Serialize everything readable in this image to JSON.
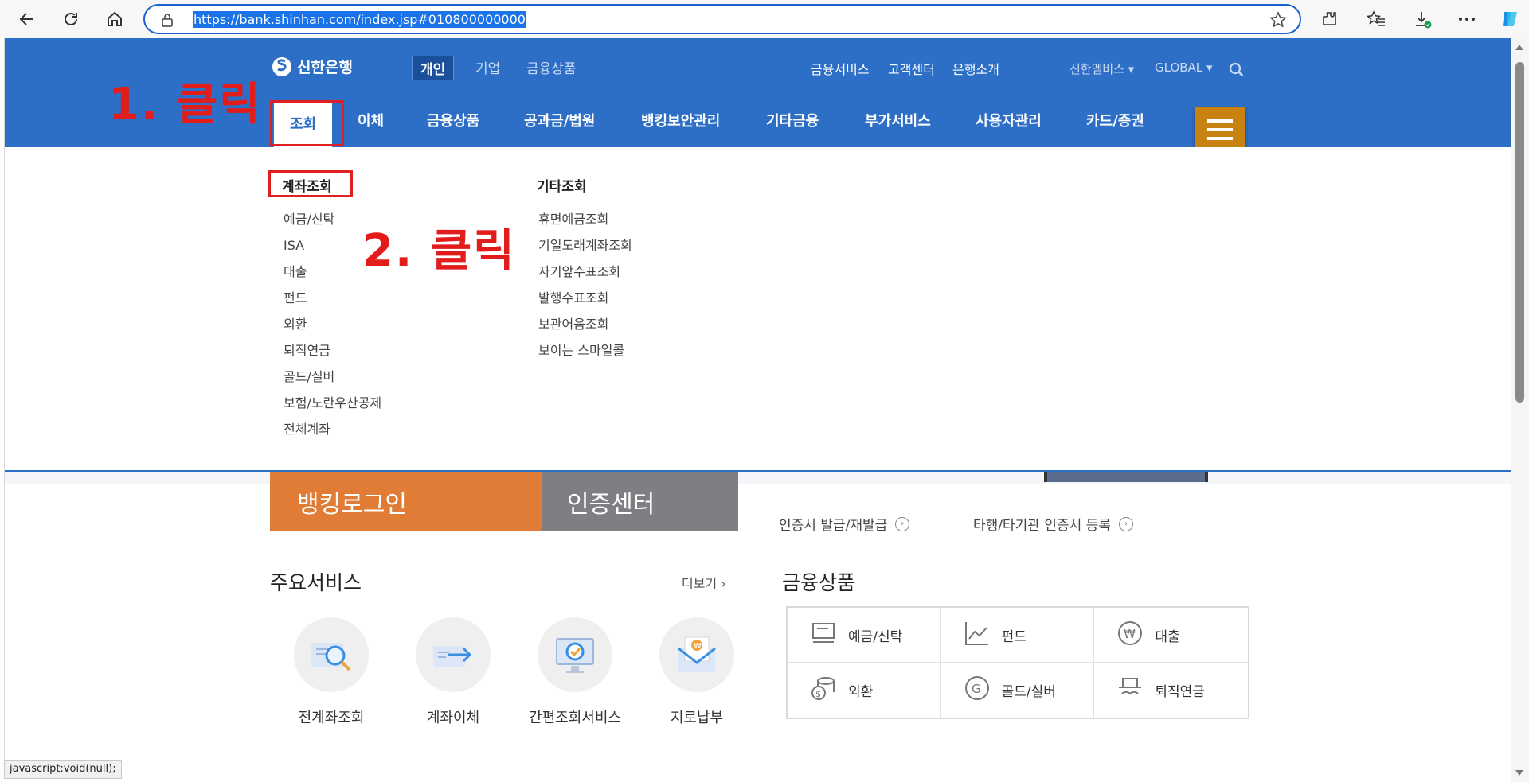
{
  "browser": {
    "url": "https://bank.shinhan.com/index.jsp#010800000000",
    "status_text": "javascript:void(null);"
  },
  "header": {
    "logo_text": "신한은행",
    "top_tabs": [
      "개인",
      "기업",
      "금융상품"
    ],
    "util_links": [
      "금융서비스",
      "고객센터",
      "은행소개"
    ],
    "member_link": "신한멤버스",
    "global_link": "GLOBAL"
  },
  "main_nav": [
    "조회",
    "이체",
    "금융상품",
    "공과금/법원",
    "뱅킹보안관리",
    "기타금융",
    "부가서비스",
    "사용자관리",
    "카드/증권"
  ],
  "annotations": {
    "step1": "1. 클릭",
    "step2": "2. 클릭"
  },
  "dropdown": {
    "col1": {
      "title": "계좌조회",
      "items": [
        "예금/신탁",
        "ISA",
        "대출",
        "펀드",
        "외환",
        "퇴직연금",
        "골드/실버",
        "보험/노란우산공제",
        "전체계좌"
      ]
    },
    "col2": {
      "title": "기타조회",
      "items": [
        "휴면예금조회",
        "기일도래계좌조회",
        "자기앞수표조회",
        "발행수표조회",
        "보관어음조회",
        "보이는 스마일콜"
      ]
    }
  },
  "content": {
    "login_button": "뱅킹로그인",
    "cert_button": "인증센터",
    "cert_links": [
      "인증서 발급/재발급",
      "타행/타기관 인증서 등록"
    ],
    "main_services_title": "주요서비스",
    "more_label": "더보기",
    "services": [
      "전계좌조회",
      "계좌이체",
      "간편조회서비스",
      "지로납부"
    ],
    "products_title": "금융상품",
    "products": [
      "예금/신탁",
      "펀드",
      "대출",
      "외환",
      "골드/실버",
      "퇴직연금"
    ]
  },
  "colors": {
    "header_blue": "#2d6fc6",
    "accent_orange": "#e07c36",
    "menu_button": "#c9820f",
    "annotation_red": "#e21b1b"
  }
}
